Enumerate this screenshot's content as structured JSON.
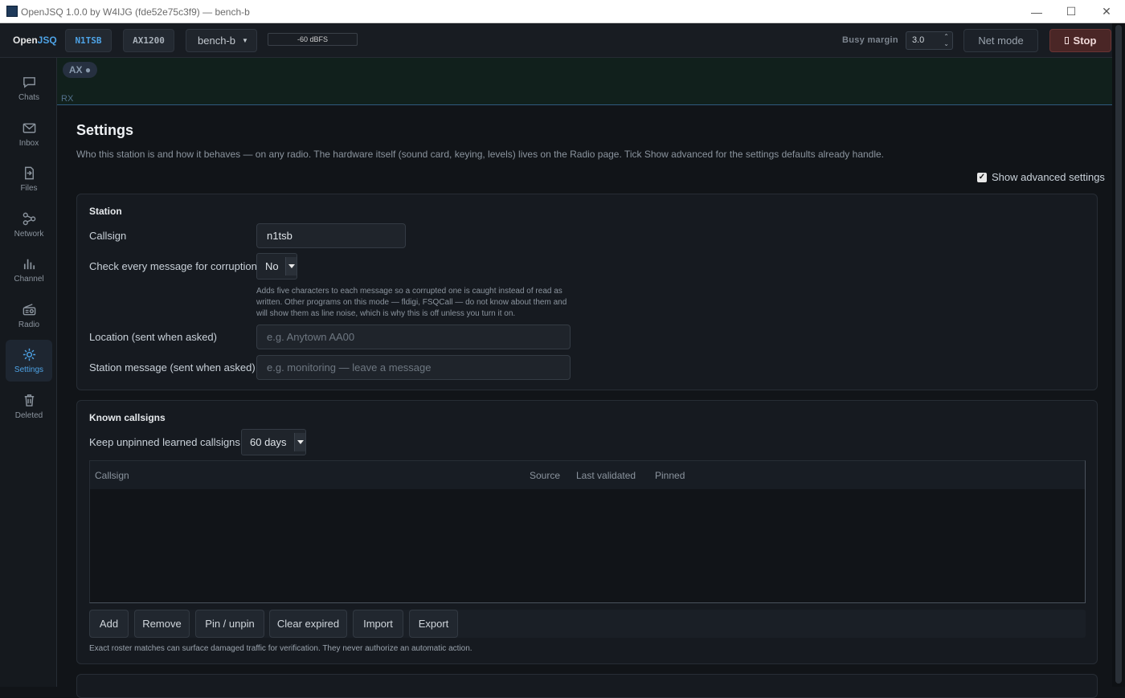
{
  "window": {
    "title": "OpenJSQ 1.0.0 by W4IJG (fde52e75c3f9) — bench-b",
    "minimize": "—",
    "maximize": "☐",
    "close": "✕"
  },
  "topbar": {
    "logo_open": "Open",
    "logo_jsq": "JSQ",
    "callsign_chip": "N1TSB",
    "mode_chip": "AX1200",
    "profile_select": "bench-b",
    "level_meter": "-60 dBFS",
    "busy_margin_label": "Busy margin",
    "busy_margin_value": "3.0",
    "net_mode_label": "Net mode",
    "stop_label": "Stop"
  },
  "sidebar": {
    "items": [
      {
        "label": "Chats",
        "icon": "chat-bubble-icon"
      },
      {
        "label": "Inbox",
        "icon": "envelope-icon"
      },
      {
        "label": "Files",
        "icon": "file-import-icon"
      },
      {
        "label": "Network",
        "icon": "network-nodes-icon"
      },
      {
        "label": "Channel",
        "icon": "bar-chart-icon"
      },
      {
        "label": "Radio",
        "icon": "radio-icon"
      },
      {
        "label": "Settings",
        "icon": "gear-icon"
      },
      {
        "label": "Deleted",
        "icon": "trash-icon"
      }
    ],
    "active": "Settings"
  },
  "rx": {
    "mode_chip": "AX ●",
    "label": "RX"
  },
  "settings": {
    "title": "Settings",
    "description": "Who this station is and how it behaves — on any radio. The hardware itself (sound card, keying, levels) lives on the Radio page. Tick Show advanced for the settings defaults already handle.",
    "show_advanced_label": "Show advanced settings",
    "show_advanced_checked": true,
    "station": {
      "title": "Station",
      "callsign_label": "Callsign",
      "callsign_value": "n1tsb",
      "corruption_label": "Check every message for corruption",
      "corruption_value": "No",
      "corruption_help": "Adds five characters to each message so a corrupted one is caught instead of read as written. Other programs on this mode — fldigi, FSQCall — do not know about them and will show them as line noise, which is why this is off unless you turn it on.",
      "location_label": "Location (sent when asked)",
      "location_placeholder": "e.g. Anytown AA00",
      "message_label": "Station message (sent when asked)",
      "message_placeholder": "e.g. monitoring — leave a message"
    },
    "known_callsigns": {
      "title": "Known callsigns",
      "keep_label": "Keep unpinned learned callsigns",
      "keep_value": "60 days",
      "columns": [
        "Callsign",
        "Source",
        "Last validated",
        "Pinned"
      ],
      "rows": [],
      "buttons": [
        "Add",
        "Remove",
        "Pin / unpin",
        "Clear expired",
        "Import",
        "Export"
      ],
      "footnote": "Exact roster matches can surface damaged traffic for verification. They never authorize an automatic action."
    }
  }
}
